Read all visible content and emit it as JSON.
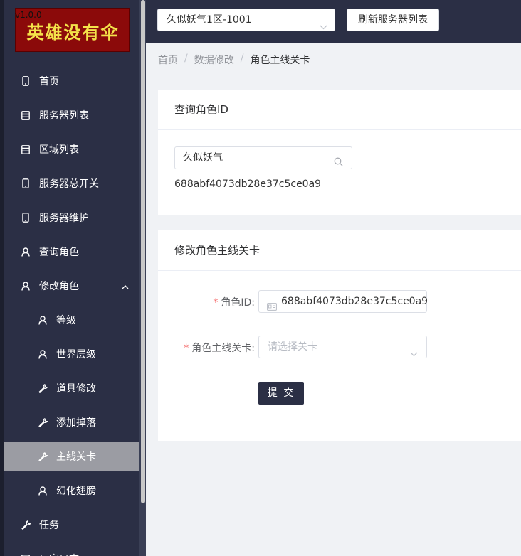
{
  "logo": {
    "text": "英雄没有伞",
    "version": "v1.0.0"
  },
  "sidebar": {
    "items": [
      {
        "label": "首页",
        "icon": "phone-icon"
      },
      {
        "label": "服务器列表",
        "icon": "list-icon"
      },
      {
        "label": "区域列表",
        "icon": "list-icon"
      },
      {
        "label": "服务器总开关",
        "icon": "phone-icon"
      },
      {
        "label": "服务器维护",
        "icon": "phone-icon"
      },
      {
        "label": "查询角色",
        "icon": "user-icon"
      },
      {
        "label": "修改角色",
        "icon": "user-icon",
        "expanded": true
      },
      {
        "label": "等级",
        "icon": "user-icon",
        "sub": true
      },
      {
        "label": "世界层级",
        "icon": "user-icon",
        "sub": true
      },
      {
        "label": "道具修改",
        "icon": "wrench-icon",
        "sub": true
      },
      {
        "label": "添加掉落",
        "icon": "wrench-icon",
        "sub": true
      },
      {
        "label": "主线关卡",
        "icon": "wrench-icon",
        "sub": true,
        "active": true
      },
      {
        "label": "幻化翅膀",
        "icon": "user-icon",
        "sub": true
      },
      {
        "label": "任务",
        "icon": "wrench-icon"
      },
      {
        "label": "玩家日志",
        "icon": "list-icon"
      }
    ]
  },
  "topbar": {
    "server_select_value": "久似妖气1区-1001",
    "refresh_label": "刷新服务器列表"
  },
  "breadcrumb": {
    "home": "首页",
    "section": "数据修改",
    "current": "角色主线关卡"
  },
  "query_card": {
    "title": "查询角色ID",
    "search_value": "久似妖气",
    "result_id": "688abf4073db28e37c5ce0a9"
  },
  "edit_card": {
    "title": "修改角色主线关卡",
    "role_id_label": "角色ID:",
    "role_id_value": "688abf4073db28e37c5ce0a9",
    "stage_label": "角色主线关卡:",
    "stage_placeholder": "请选择关卡",
    "submit_label": "提 交"
  },
  "colors": {
    "sidebar_bg": "#2b2f45",
    "active_bg": "#9b9ca3",
    "logo_bg": "#8b0a0a",
    "logo_text": "#f4e24a",
    "required": "#f56c6c"
  }
}
